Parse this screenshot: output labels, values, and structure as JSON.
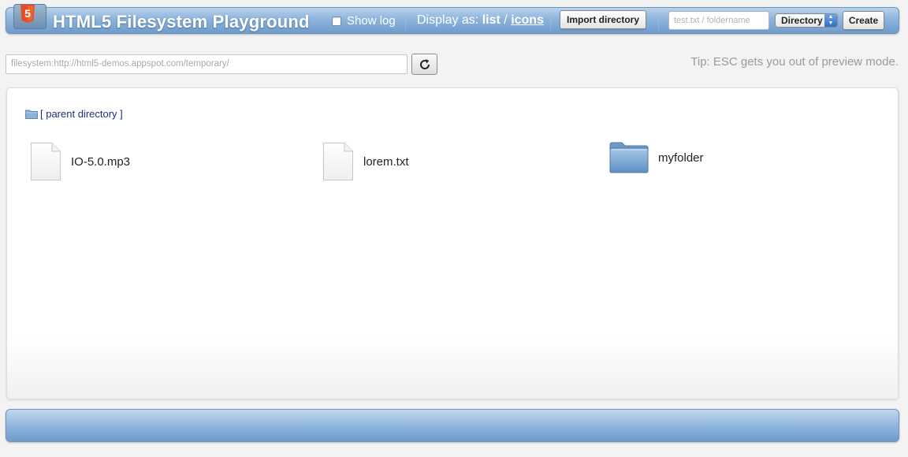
{
  "header": {
    "title": "HTML5 Filesystem Playground",
    "logo_icon": "html5-folder-logo",
    "logo_text": "5",
    "show_log_label": "Show log",
    "show_log_checked": false,
    "display_as_label": "Display as:",
    "display_list": "list",
    "display_sep": "/",
    "display_icons": "icons",
    "import_button": "Import directory",
    "name_placeholder": "test.txt / foldername",
    "type_select_value": "Directory",
    "create_button": "Create"
  },
  "path_bar": {
    "value": "filesystem:http://html5-demos.appspot.com/temporary/",
    "refresh_icon": "refresh-icon"
  },
  "tip": "Tip: ESC gets you out of preview mode.",
  "browser": {
    "parent_label": "[ parent directory ]",
    "items": [
      {
        "name": "IO-5.0.mp3",
        "icon": "file-icon"
      },
      {
        "name": "lorem.txt",
        "icon": "file-icon"
      },
      {
        "name": "myfolder",
        "icon": "folder-icon"
      }
    ]
  },
  "colors": {
    "header_blue": "#8db4dc",
    "link_navy": "#1f2f7a",
    "html5_orange": "#e44d26"
  }
}
